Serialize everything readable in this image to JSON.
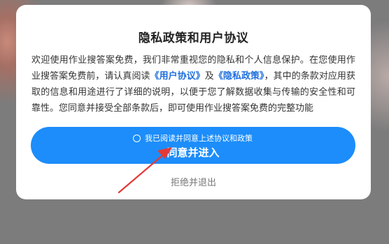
{
  "dialog": {
    "title": "隐私政策和用户协议",
    "intro": "欢迎使用作业搜答案免费，我们非常重视您的隐私和个人信息保护。在您使用作业搜答案免费前，请认真阅读",
    "user_agreement_link": "《用户协议》",
    "and": "及",
    "privacy_policy_link": "《隐私政策》",
    "rest": "，其中的条款对应用获取的信息和用途进行了详细的说明，以便于您了解数据收集与传输的安全性和可靠性。您同意并接受全部条款后，即可使用作业搜答案免费的完整功能",
    "consent_label": "我已阅读并同意上述协议和政策",
    "agree_button": "同意并进入",
    "reject_button": "拒绝并退出"
  },
  "colors": {
    "primary_button": "#1c8dfa",
    "link": "#1e6fdd",
    "annotation_arrow": "#e53935"
  },
  "icons": {
    "consent": "radio-circle-icon",
    "annotation": "red-arrow-icon"
  }
}
